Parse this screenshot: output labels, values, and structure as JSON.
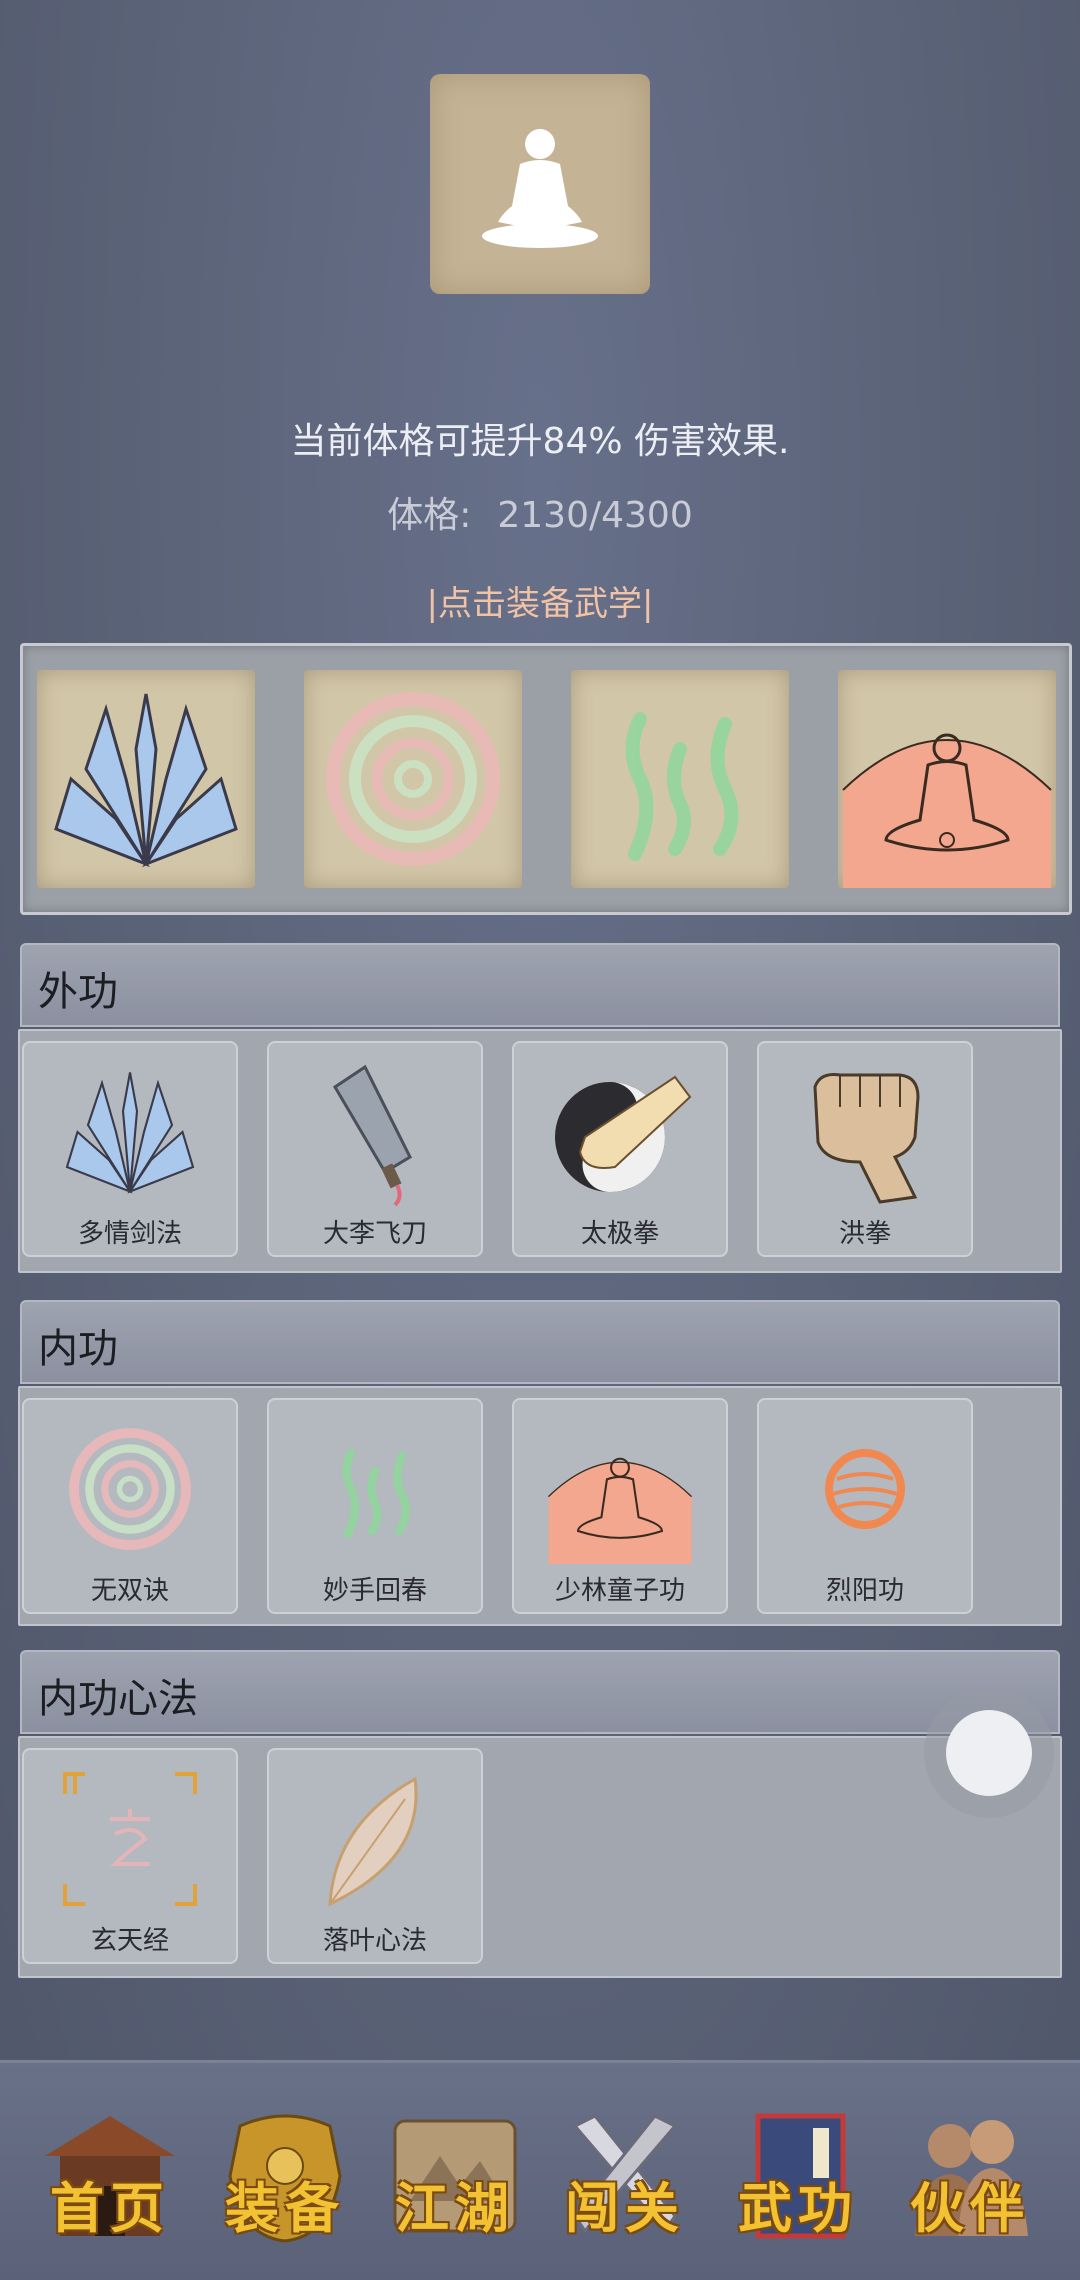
{
  "header": {
    "bonus_text": "当前体格可提升84% 伤害效果.",
    "stat_label": "体格:",
    "stat_value": "2130/4300",
    "equip_link": "|点击装备武学|"
  },
  "equipped_slots": [
    {
      "icon": "blade-fan-icon"
    },
    {
      "icon": "spiral-icon"
    },
    {
      "icon": "green-wave-icon"
    },
    {
      "icon": "meditating-monk-icon"
    }
  ],
  "sections": [
    {
      "title": "外功",
      "skills": [
        {
          "label": "多情剑法",
          "icon": "blade-fan-icon"
        },
        {
          "label": "大李飞刀",
          "icon": "cleaver-icon"
        },
        {
          "label": "太极拳",
          "icon": "taiji-fist-icon"
        },
        {
          "label": "洪拳",
          "icon": "fist-icon"
        }
      ]
    },
    {
      "title": "内功",
      "skills": [
        {
          "label": "无双诀",
          "icon": "spiral-icon"
        },
        {
          "label": "妙手回春",
          "icon": "green-wave-icon"
        },
        {
          "label": "少林童子功",
          "icon": "meditating-monk-icon"
        },
        {
          "label": "烈阳功",
          "icon": "sun-orb-icon"
        }
      ]
    },
    {
      "title": "内功心法",
      "skills": [
        {
          "label": "玄天经",
          "icon": "xuan-rune-icon"
        },
        {
          "label": "落叶心法",
          "icon": "leaf-icon"
        }
      ]
    }
  ],
  "nav": [
    {
      "label": "首页",
      "icon": "house-icon"
    },
    {
      "label": "装备",
      "icon": "armor-icon"
    },
    {
      "label": "江湖",
      "icon": "scroll-map-icon"
    },
    {
      "label": "闯关",
      "icon": "crossed-swords-icon"
    },
    {
      "label": "武功",
      "icon": "book-icon"
    },
    {
      "label": "伙伴",
      "icon": "partners-icon"
    }
  ],
  "colors": {
    "background": "#5b6378",
    "link": "#f0c2a6",
    "nav_text": "#f2c232"
  }
}
